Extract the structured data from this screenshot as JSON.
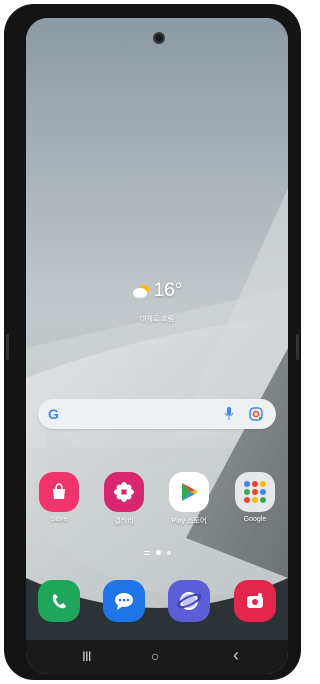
{
  "weather": {
    "temperature": "16°",
    "location": "대체로 흐림"
  },
  "search": {
    "logo": "G"
  },
  "apps": [
    {
      "name": "store",
      "label": "Store",
      "color": "#f0356b"
    },
    {
      "name": "gallery",
      "label": "갤러리",
      "color": "#d8266e"
    },
    {
      "name": "play-store",
      "label": "Play 스토어",
      "color": "#ffffff"
    },
    {
      "name": "google-folder",
      "label": "Google",
      "color": "#e6e8ea"
    }
  ],
  "dock": [
    {
      "name": "phone",
      "color": "#1fa65a"
    },
    {
      "name": "messages",
      "color": "#1f74e8"
    },
    {
      "name": "internet",
      "color": "#5a5fd8"
    },
    {
      "name": "camera",
      "color": "#e3264a"
    }
  ],
  "nav": {
    "recents": "III",
    "home": "○",
    "back": "‹"
  }
}
